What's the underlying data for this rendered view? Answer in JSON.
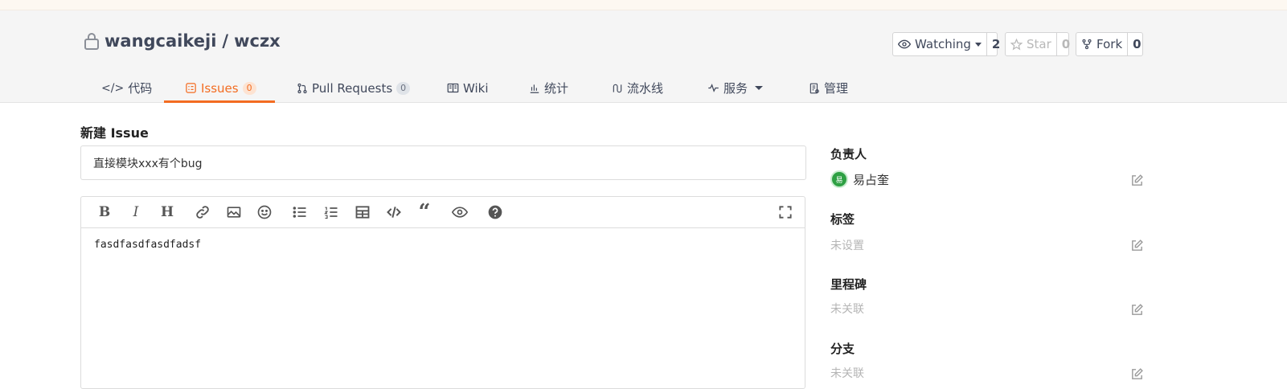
{
  "repo": {
    "owner": "wangcaikeji",
    "separator": "/",
    "name": "wczx"
  },
  "actions": {
    "watch": {
      "label": "Watching",
      "count": "2"
    },
    "star": {
      "label": "Star",
      "count": "0"
    },
    "fork": {
      "label": "Fork",
      "count": "0"
    }
  },
  "tabs": [
    {
      "label": "代码"
    },
    {
      "label": "Issues",
      "badge": "0"
    },
    {
      "label": "Pull Requests",
      "badge": "0"
    },
    {
      "label": "Wiki"
    },
    {
      "label": "统计"
    },
    {
      "label": "流水线"
    },
    {
      "label": "服务"
    },
    {
      "label": "管理"
    }
  ],
  "form": {
    "heading": "新建 Issue",
    "title_value": "直接模块xxx有个bug",
    "body_text": "fasdfasdfasdfadsf"
  },
  "sidebar": {
    "assignee_label": "负责人",
    "assignee_name": "易占奎",
    "assignee_avatar_text": "易",
    "labels_label": "标签",
    "labels_value": "未设置",
    "milestone_label": "里程碑",
    "milestone_value": "未关联",
    "branch_label": "分支",
    "branch_value": "未关联"
  },
  "colors": {
    "accent": "#f36c21",
    "text": "#40485b",
    "avatar": "#2ea043"
  }
}
